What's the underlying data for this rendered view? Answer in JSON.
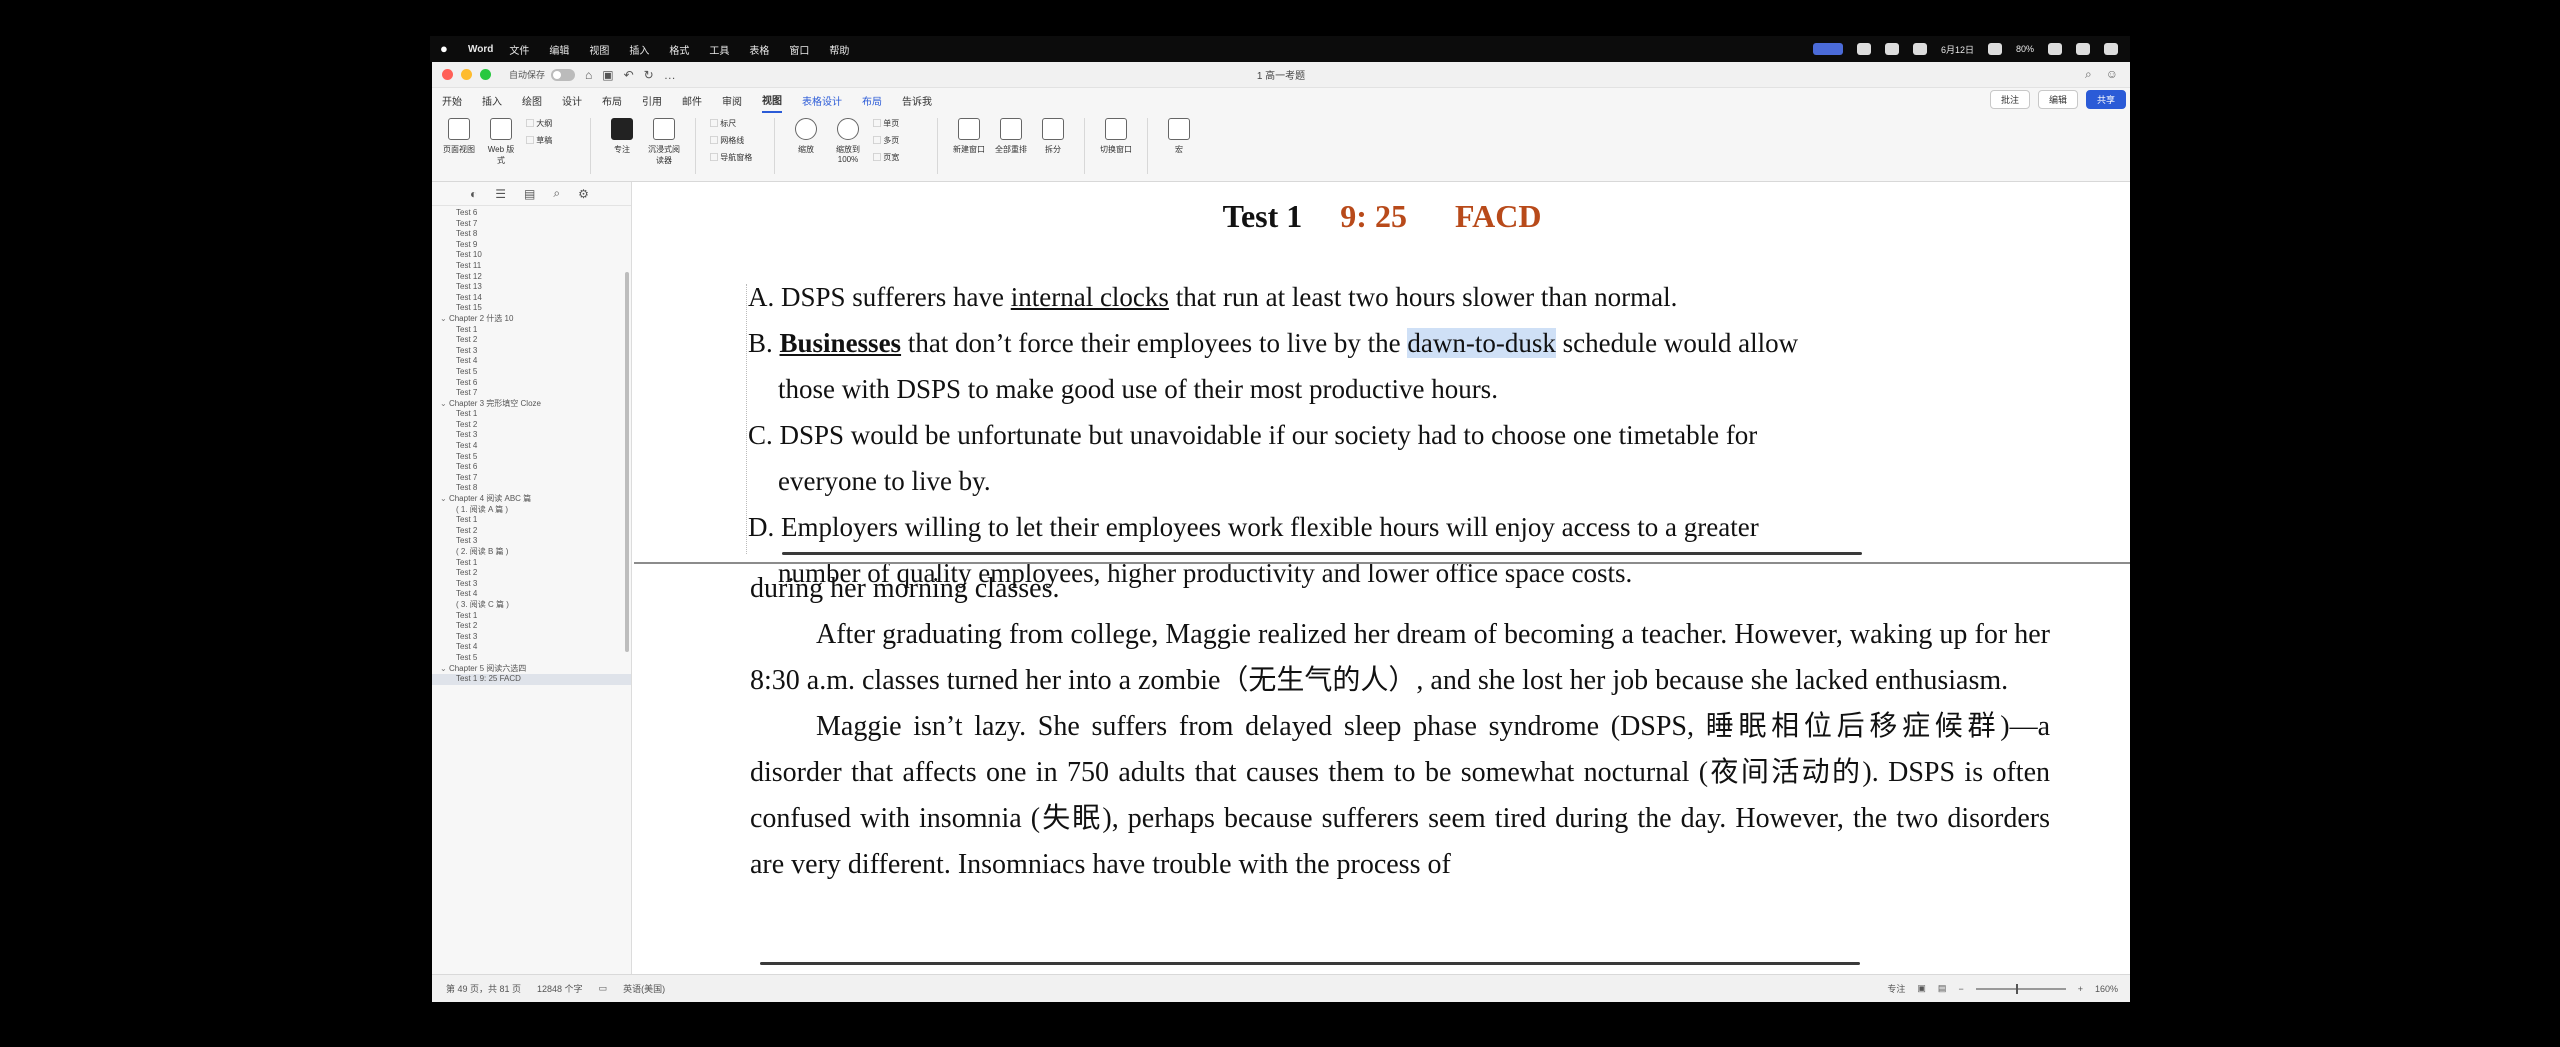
{
  "menubar": {
    "app_name": "Word",
    "items": [
      "文件",
      "编辑",
      "视图",
      "插入",
      "格式",
      "工具",
      "表格",
      "窗口",
      "帮助"
    ],
    "date": "6月12日",
    "battery": "80%"
  },
  "window": {
    "autosave_label": "自动保存",
    "doc_title": "1 高一考题"
  },
  "tabs": [
    "开始",
    "插入",
    "绘图",
    "设计",
    "布局",
    "引用",
    "邮件",
    "审阅",
    "视图",
    "表格设计",
    "布局",
    "告诉我"
  ],
  "active_tab": "视图",
  "tab_right": {
    "comments": "批注",
    "editing": "编辑",
    "share": "共享"
  },
  "ribbon": {
    "buttons": [
      "页面视图",
      "Web 版式",
      "大纲",
      "草稿",
      "专注",
      "沉浸式阅读器",
      "标尺",
      "网格线",
      "导航窗格",
      "缩放",
      "缩放到100%",
      "单页",
      "多页",
      "页宽",
      "新建窗口",
      "全部重排",
      "拆分",
      "切换窗口",
      "宏"
    ]
  },
  "sidebar": {
    "items": [
      {
        "label": "Test 6",
        "level": 1
      },
      {
        "label": "Test 7",
        "level": 1
      },
      {
        "label": "Test 8",
        "level": 1
      },
      {
        "label": "Test 9",
        "level": 1
      },
      {
        "label": "Test 10",
        "level": 1
      },
      {
        "label": "Test 11",
        "level": 1
      },
      {
        "label": "Test 12",
        "level": 1
      },
      {
        "label": "Test 13",
        "level": 1
      },
      {
        "label": "Test 14",
        "level": 1
      },
      {
        "label": "Test 15",
        "level": 1
      },
      {
        "label": "Chapter 2  什选 10",
        "level": 0
      },
      {
        "label": "Test 1",
        "level": 1
      },
      {
        "label": "Test 2",
        "level": 1
      },
      {
        "label": "Test 3",
        "level": 1
      },
      {
        "label": "Test 4",
        "level": 1
      },
      {
        "label": "Test 5",
        "level": 1
      },
      {
        "label": "Test 6",
        "level": 1
      },
      {
        "label": "Test 7",
        "level": 1
      },
      {
        "label": "Chapter 3  完形填空 Cloze",
        "level": 0
      },
      {
        "label": "Test 1",
        "level": 1
      },
      {
        "label": "Test 2",
        "level": 1
      },
      {
        "label": "Test 3",
        "level": 1
      },
      {
        "label": "Test 4",
        "level": 1
      },
      {
        "label": "Test 5",
        "level": 1
      },
      {
        "label": "Test 6",
        "level": 1
      },
      {
        "label": "Test 7",
        "level": 1
      },
      {
        "label": "Test 8",
        "level": 1
      },
      {
        "label": "Chapter 4  阅读 ABC 篇",
        "level": 0
      },
      {
        "label": "( 1. 阅读 A 篇 )",
        "level": 1
      },
      {
        "label": "Test 1",
        "level": 1
      },
      {
        "label": "Test 2",
        "level": 1
      },
      {
        "label": "Test 3",
        "level": 1
      },
      {
        "label": "( 2. 阅读 B 篇 )",
        "level": 1
      },
      {
        "label": "Test 1",
        "level": 1
      },
      {
        "label": "Test 2",
        "level": 1
      },
      {
        "label": "Test 3",
        "level": 1
      },
      {
        "label": "Test 4",
        "level": 1
      },
      {
        "label": "( 3. 阅读 C 篇 )",
        "level": 1
      },
      {
        "label": "Test 1",
        "level": 1
      },
      {
        "label": "Test 2",
        "level": 1
      },
      {
        "label": "Test 3",
        "level": 1
      },
      {
        "label": "Test 4",
        "level": 1
      },
      {
        "label": "Test 5",
        "level": 1
      },
      {
        "label": "Chapter 5  阅读六选四",
        "level": 0
      },
      {
        "label": "Test 1  9:  25  FACD",
        "level": 1,
        "selected": true
      }
    ]
  },
  "document": {
    "heading": {
      "test": "Test 1",
      "time": "9:  25",
      "answers": "FACD"
    },
    "options": {
      "a": {
        "prefix": "A. DSPS sufferers have ",
        "underlined": "internal clocks",
        "suffix": " that run at least two hours slower than normal."
      },
      "b": {
        "prefix": "B. ",
        "bold": "Businesses",
        "middle": " that don’t force their employees to live by the ",
        "highlight": "dawn-to-dusk",
        "suffix": " schedule would allow those with DSPS to make good use of their most productive hours."
      },
      "c": "C. DSPS would be unfortunate but unavoidable if our society had to choose one timetable for everyone to live by.",
      "d": "D. Employers willing to let their employees work flexible hours will enjoy access to a greater number of quality employees, higher productivity and lower office space costs."
    },
    "passage": {
      "line0": "during her morning classes.",
      "p1": "After graduating from college, Maggie realized her dream of becoming a teacher. However, waking up for her 8:30 a.m. classes turned her into a zombie（无生气的人）, and she lost her job because she lacked enthusiasm.",
      "p2": "Maggie isn’t lazy. She suffers from delayed sleep phase syndrome (DSPS, 睡眠相位后移症候群)—a disorder that affects one in 750 adults that causes them to be somewhat nocturnal (夜间活动的). DSPS is often confused with insomnia (失眠), perhaps because sufferers seem tired during the day. However, the two disorders are very different. Insomniacs have trouble with the process of"
    }
  },
  "statusbar": {
    "pages": "第 49 页，共 81 页",
    "words": "12848 个字",
    "language": "英语(美国)",
    "focus": "专注",
    "zoom": "160%"
  }
}
